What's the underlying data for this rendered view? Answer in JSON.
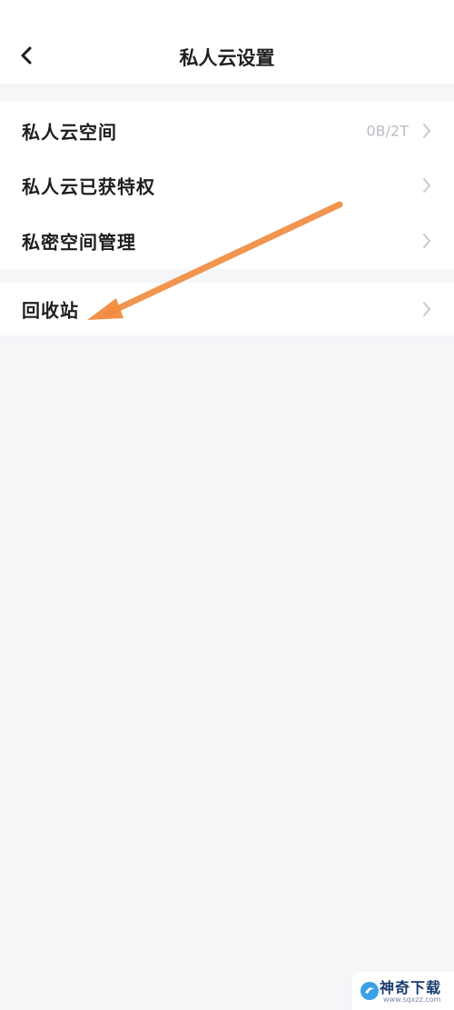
{
  "header": {
    "title": "私人云设置",
    "back_icon": "chevron-left-icon"
  },
  "settings": {
    "group1": [
      {
        "label": "私人云空间",
        "value": "0B/2T"
      },
      {
        "label": "私人云已获特权",
        "value": ""
      },
      {
        "label": "私密空间管理",
        "value": ""
      }
    ],
    "group2": [
      {
        "label": "回收站",
        "value": ""
      }
    ]
  },
  "annotation": {
    "arrow_color": "#f08a3c"
  },
  "watermark": {
    "name": "神奇下载",
    "url": "www.sqxzz.com"
  },
  "colors": {
    "background": "#f4f6f8",
    "card": "#ffffff",
    "text_primary": "#1e1e1e",
    "text_secondary": "#b8bcc2"
  }
}
